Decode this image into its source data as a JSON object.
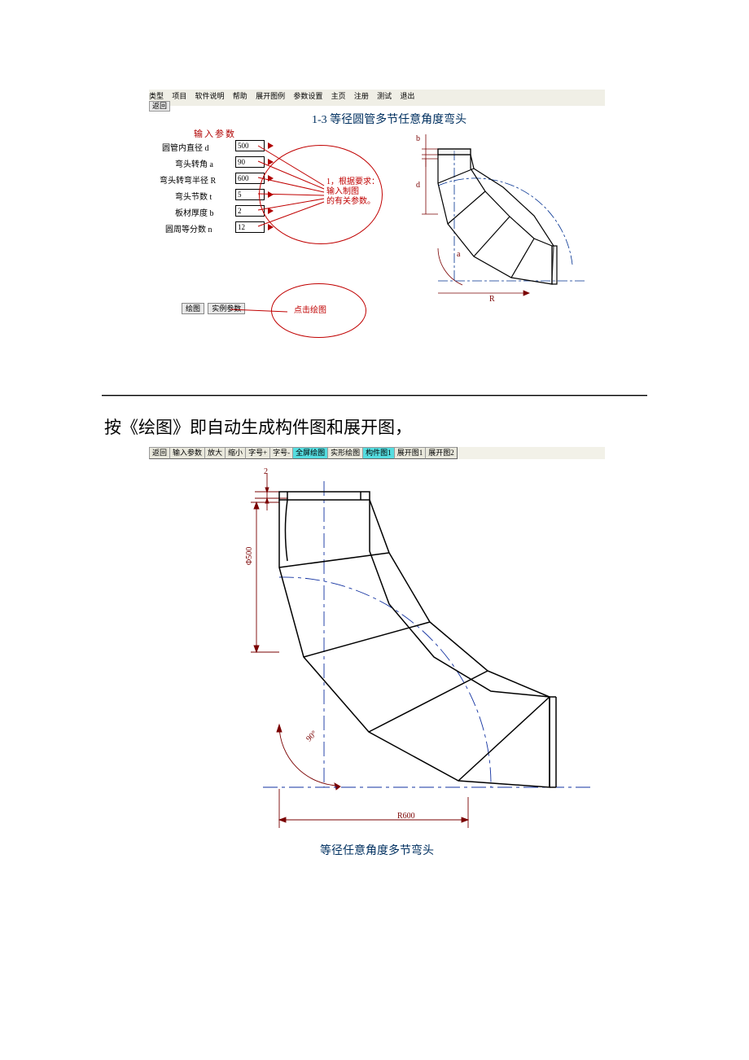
{
  "panel1": {
    "menu": [
      "类型",
      "项目",
      "软件说明",
      "帮助",
      "展开图例",
      "参数设置",
      "主页",
      "注册",
      "测试",
      "退出"
    ],
    "back": "返回",
    "title": "1-3 等径圆管多节任意角度弯头",
    "input_header": "输入参数",
    "params": [
      {
        "label": "圆管内直径 d",
        "value": "500"
      },
      {
        "label": "弯头转角 a",
        "value": "90"
      },
      {
        "label": "弯头转弯半径 R",
        "value": "600"
      },
      {
        "label": "弯头节数 t",
        "value": "5"
      },
      {
        "label": "板材厚度 b",
        "value": "2"
      },
      {
        "label": "圆周等分数 n",
        "value": "12"
      }
    ],
    "buttons": {
      "draw": "绘图",
      "example": "实例参数"
    },
    "annotation1_l1": "1，根据要求：",
    "annotation1_l2": "输入制图",
    "annotation1_l3": "的有关参数。",
    "annotation2": "点击绘图",
    "dims": {
      "a": "a",
      "R": "R",
      "d": "d",
      "b": "b"
    }
  },
  "mid_caption": "按《绘图》即自动生成构件图和展开图，",
  "panel2": {
    "toolbar": [
      "返回",
      "输入参数",
      "放大",
      "缩小",
      "字号+",
      "字号-",
      "全屏绘图",
      "实形绘图",
      "构件图1",
      "展开图1",
      "展开图2"
    ],
    "toolbar_highlight_idx": [
      6,
      8
    ],
    "dims": {
      "phi": "Φ500",
      "R": "R600",
      "angle": "90°",
      "b": "2"
    },
    "title": "等径任意角度多节弯头"
  }
}
